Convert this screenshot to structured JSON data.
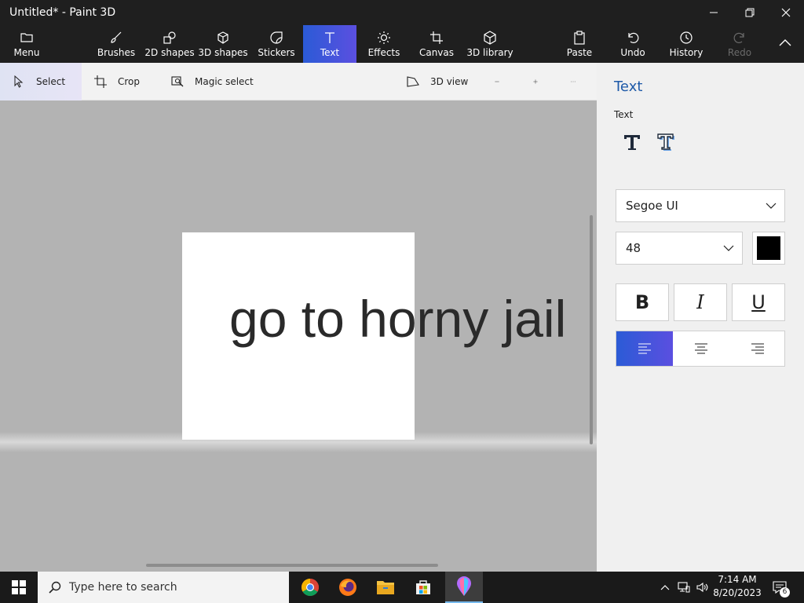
{
  "window": {
    "title": "Untitled* - Paint 3D"
  },
  "ribbon": {
    "menu": "Menu",
    "brushes": "Brushes",
    "shapes2d": "2D shapes",
    "shapes3d": "3D shapes",
    "stickers": "Stickers",
    "text": "Text",
    "effects": "Effects",
    "canvas": "Canvas",
    "library3d": "3D library",
    "paste": "Paste",
    "undo": "Undo",
    "history": "History",
    "redo": "Redo"
  },
  "toolbar": {
    "select": "Select",
    "crop": "Crop",
    "magic_select": "Magic select",
    "view3d": "3D view"
  },
  "canvas": {
    "text": "go to horny jail"
  },
  "panel": {
    "title": "Text",
    "section_label": "Text",
    "font": "Segoe UI",
    "size": "48",
    "color": "#000000",
    "bold": "B",
    "italic": "I",
    "underline": "U"
  },
  "taskbar": {
    "search_placeholder": "Type here to search",
    "time": "7:14 AM",
    "date": "8/20/2023",
    "notifications": "6"
  },
  "colors": {
    "accent_start": "#2b5bd6",
    "accent_end": "#5b4fe0",
    "panel_title": "#1e5aa8"
  }
}
